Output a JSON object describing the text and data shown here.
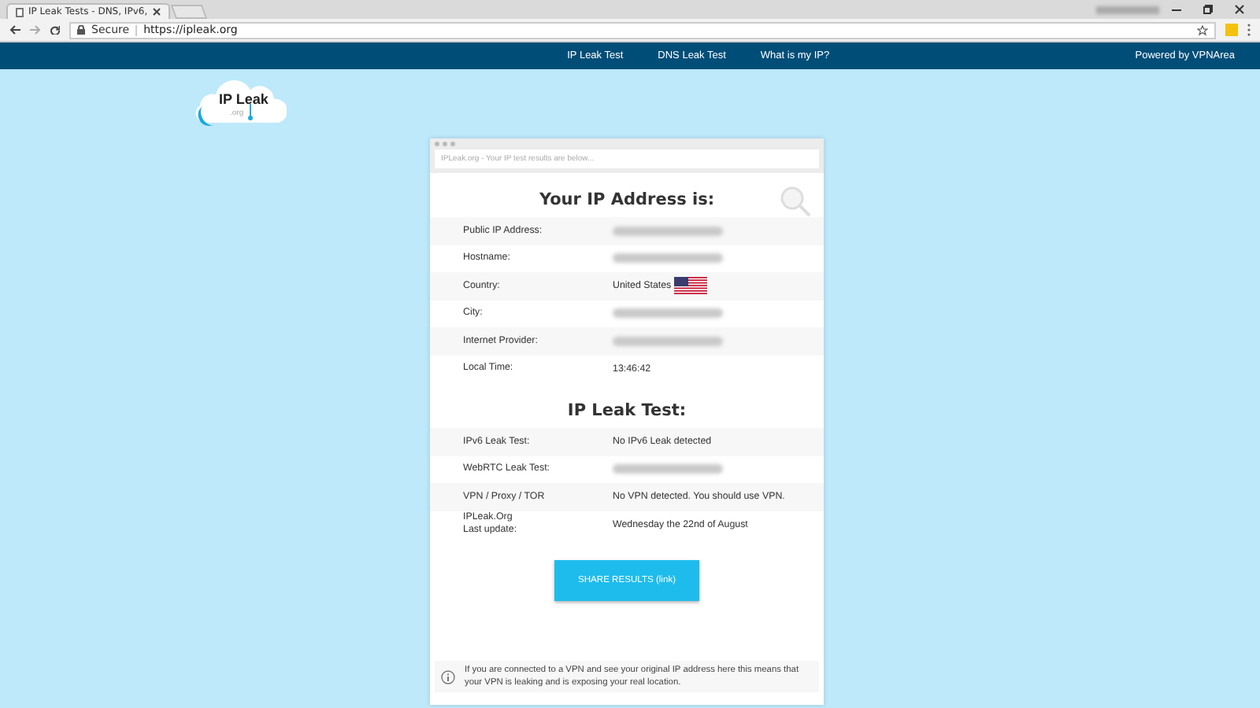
{
  "browser": {
    "tab_title": "IP Leak Tests - DNS, IPv6,",
    "secure_label": "Secure",
    "url": "https://ipleak.org"
  },
  "nav": {
    "links": [
      "IP Leak Test",
      "DNS Leak Test",
      "What is my IP?"
    ],
    "powered_by": "Powered by VPNArea"
  },
  "logo": {
    "text": "IP Leak",
    "sub": ".org"
  },
  "card": {
    "address_bar": "IPLeak.org - Your IP test results are below...",
    "sections": [
      {
        "title": "Your IP Address is:",
        "rows": [
          {
            "label": "Public IP Address:",
            "kind": "blurred"
          },
          {
            "label": "Hostname:",
            "kind": "blurred"
          },
          {
            "label": "Country:",
            "kind": "flag",
            "value": "United States"
          },
          {
            "label": "City:",
            "kind": "blurred"
          },
          {
            "label": "Internet Provider:",
            "kind": "blurred"
          },
          {
            "label": "Local Time:",
            "kind": "text",
            "value": "13:46:42"
          }
        ]
      },
      {
        "title": "IP Leak Test:",
        "rows": [
          {
            "label": "IPv6 Leak Test:",
            "kind": "text",
            "value": "No IPv6 Leak detected"
          },
          {
            "label": "WebRTC Leak Test:",
            "kind": "blurred"
          },
          {
            "label": "VPN / Proxy / TOR",
            "kind": "text",
            "value": "No VPN detected. You should use VPN."
          },
          {
            "label": "IPLeak.Org\nLast update:",
            "kind": "text",
            "value": "Wednesday the 22nd of August"
          }
        ]
      }
    ],
    "share_button": "SHARE RESULTS (link)",
    "info": "If you are connected to a VPN and see your original IP address here this means that your VPN is leaking and is exposing your real location."
  }
}
